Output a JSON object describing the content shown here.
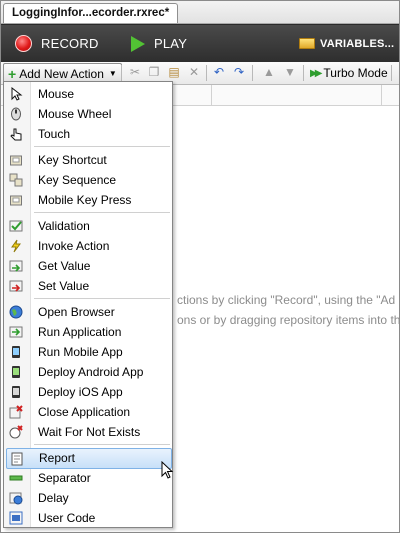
{
  "tab": {
    "title": "LoggingInfor...ecorder.rxrec*"
  },
  "runbar": {
    "record_label": "RECORD",
    "play_label": "PLAY",
    "variables_label": "VARIABLES..."
  },
  "actionbar": {
    "add_label": "Add New Action",
    "turbo_label": "Turbo Mode"
  },
  "hint": {
    "line1": "ctions by clicking \"Record\", using the \"Ad",
    "line2": "ons or by dragging repository items into th"
  },
  "menu": {
    "items": [
      {
        "label": "Mouse",
        "icon": "mouse-icon"
      },
      {
        "label": "Mouse Wheel",
        "icon": "mouse-wheel-icon"
      },
      {
        "label": "Touch",
        "icon": "touch-icon"
      },
      {
        "label": "Key Shortcut",
        "icon": "key-shortcut-icon"
      },
      {
        "label": "Key Sequence",
        "icon": "key-sequence-icon"
      },
      {
        "label": "Mobile Key Press",
        "icon": "mobile-key-press-icon"
      },
      {
        "label": "Validation",
        "icon": "validation-icon"
      },
      {
        "label": "Invoke Action",
        "icon": "invoke-action-icon"
      },
      {
        "label": "Get Value",
        "icon": "get-value-icon"
      },
      {
        "label": "Set Value",
        "icon": "set-value-icon"
      },
      {
        "label": "Open Browser",
        "icon": "open-browser-icon"
      },
      {
        "label": "Run Application",
        "icon": "run-application-icon"
      },
      {
        "label": "Run Mobile App",
        "icon": "run-mobile-app-icon"
      },
      {
        "label": "Deploy Android App",
        "icon": "deploy-android-app-icon"
      },
      {
        "label": "Deploy iOS App",
        "icon": "deploy-ios-app-icon"
      },
      {
        "label": "Close Application",
        "icon": "close-application-icon"
      },
      {
        "label": "Wait For Not Exists",
        "icon": "wait-for-not-exists-icon"
      },
      {
        "label": "Report",
        "icon": "report-icon"
      },
      {
        "label": "Separator",
        "icon": "separator-icon"
      },
      {
        "label": "Delay",
        "icon": "delay-icon"
      },
      {
        "label": "User Code",
        "icon": "user-code-icon"
      }
    ],
    "highlighted": "Report"
  },
  "colors": {
    "toolbar_dark": "#3a3a3a",
    "record_red": "#e01919",
    "play_green": "#52c234",
    "highlight": "#c7e0f8"
  }
}
